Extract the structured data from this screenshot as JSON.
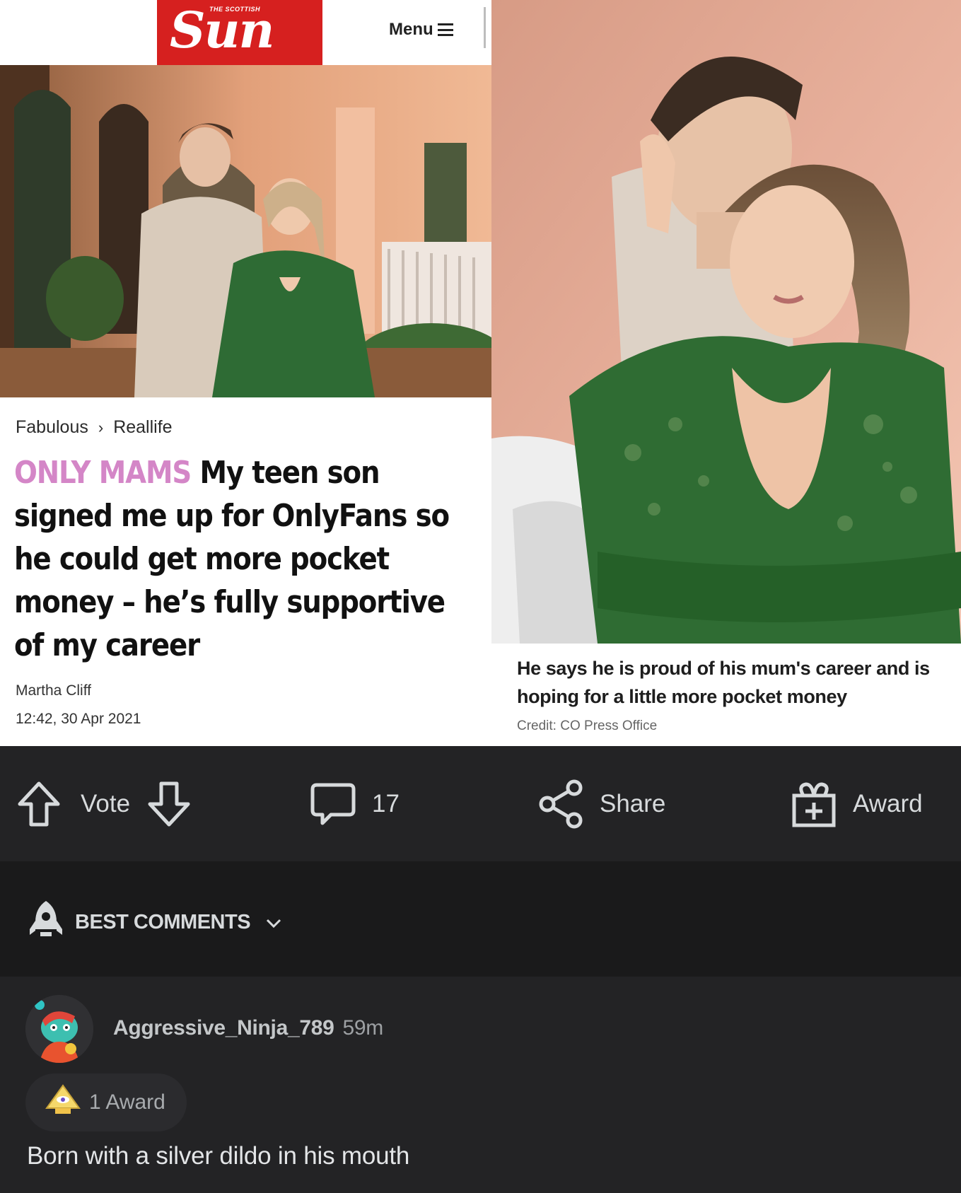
{
  "article": {
    "masthead": {
      "logo_small": "THE SCOTTISH",
      "logo": "Sun",
      "menu_label": "Menu"
    },
    "breadcrumb": [
      "Fabulous",
      "Reallife"
    ],
    "headline_kicker": "ONLY MAMS",
    "headline": "My teen son signed me up for OnlyFans so he could get more pocket money – he’s fully supportive of my career",
    "author": "Martha Cliff",
    "date": "12:42, 30 Apr 2021",
    "caption": "He says he is proud of his mum's career and is hoping for a little more pocket money",
    "credit": "Credit: CO Press Office"
  },
  "actions": {
    "vote_label": "Vote",
    "comments_count": "17",
    "share_label": "Share",
    "award_label": "Award"
  },
  "sort": {
    "label": "BEST COMMENTS"
  },
  "comment": {
    "username": "Aggressive_Ninja_789",
    "time": "59m",
    "awards": "1 Award",
    "body": "Born with a silver dildo in his mouth"
  },
  "colors": {
    "dark_bg": "#1a1a1b",
    "bar_bg": "#232325",
    "kicker_pink": "#d486c7",
    "sun_red": "#d6201f"
  }
}
